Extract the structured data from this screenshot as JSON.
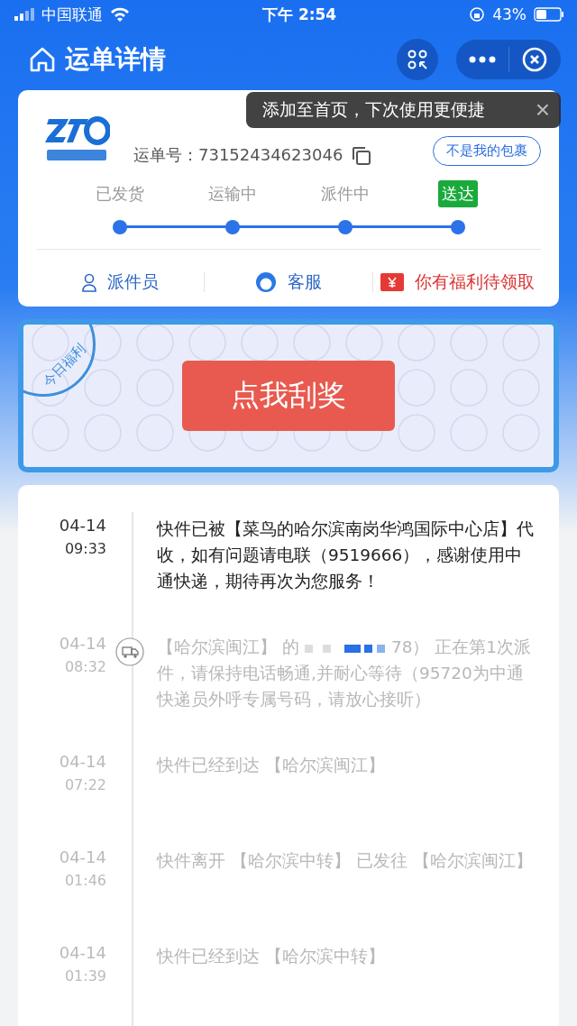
{
  "status_bar": {
    "carrier": "中国联通",
    "time": "下午 2:54",
    "battery": "43%"
  },
  "header": {
    "title": "运单详情"
  },
  "tooltip": {
    "text": "添加至首页，下次使用更便捷",
    "close": "×"
  },
  "card": {
    "tracking_label": "运单号：",
    "tracking_number": "73152434623046",
    "not_mine_button": "不是我的包裹",
    "steps": [
      {
        "label": "已发货",
        "selected": false
      },
      {
        "label": "运输中",
        "selected": false
      },
      {
        "label": "派件中",
        "selected": false
      },
      {
        "label": "送达",
        "selected": true
      }
    ],
    "actions": [
      {
        "kind": "courier",
        "label": "派件员"
      },
      {
        "kind": "service",
        "label": "客服"
      },
      {
        "kind": "gift",
        "label": "你有福利待领取"
      }
    ]
  },
  "banner": {
    "stamp": "今日福利",
    "button": "点我刮奖"
  },
  "events": [
    {
      "date": "04-14",
      "time": "09:33",
      "current": true,
      "kind": "signed",
      "text": "快件已被【菜鸟的哈尔滨南岗华鸿国际中心店】代收，如有问题请电联（9519666），感谢使用中通快递，期待再次为您服务！"
    },
    {
      "date": "04-14",
      "time": "08:32",
      "current": false,
      "kind": "dispatch",
      "text_before": "【哈尔滨闽江】 的",
      "redacted": true,
      "text": "78） 正在第1次派件，请保持电话畅通,并耐心等待（95720为中通快递员外呼专属号码，请放心接听）"
    },
    {
      "date": "04-14",
      "time": "07:22",
      "current": false,
      "kind": "transit",
      "text": "快件已经到达 【哈尔滨闽江】"
    },
    {
      "date": "04-14",
      "time": "01:46",
      "current": false,
      "kind": "transit",
      "text": "快件离开 【哈尔滨中转】 已发往 【哈尔滨闽江】"
    },
    {
      "date": "04-14",
      "time": "01:39",
      "current": false,
      "kind": "transit",
      "text": "快件已经到达 【哈尔滨中转】"
    }
  ]
}
